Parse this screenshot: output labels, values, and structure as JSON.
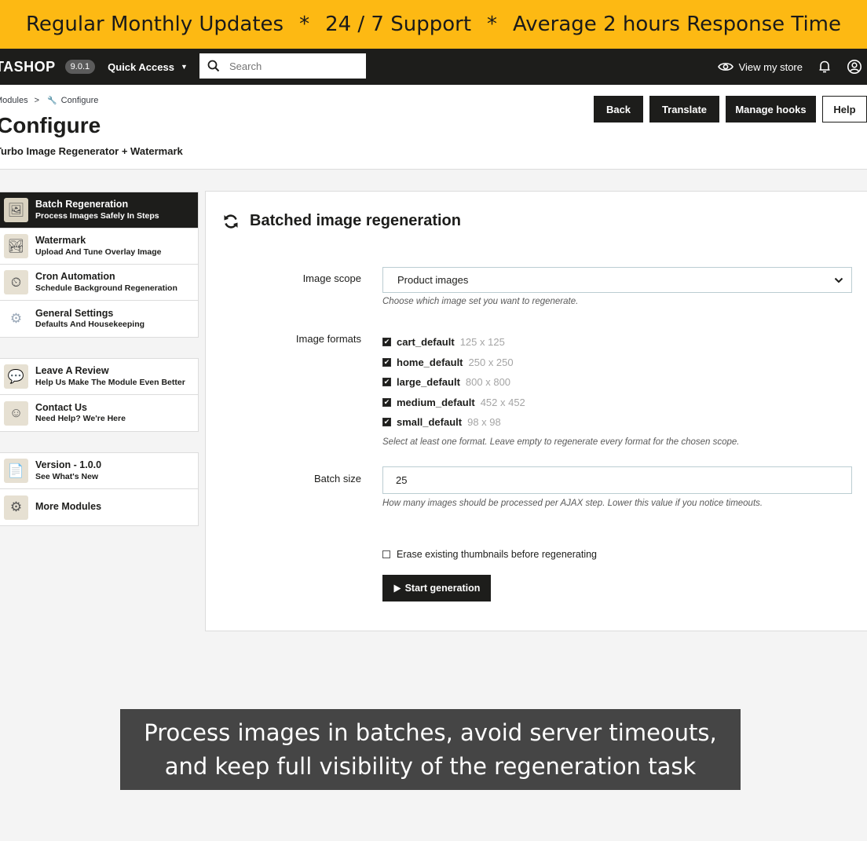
{
  "promo": {
    "items": [
      "Regular Monthly Updates",
      "24 / 7 Support",
      "Average 2 hours Response Time"
    ],
    "separator": "*"
  },
  "topnav": {
    "brand": "TASHOP",
    "version": "9.0.1",
    "quick_access": "Quick Access",
    "search_placeholder": "Search",
    "view_store": "View my store"
  },
  "header": {
    "breadcrumb": [
      "Modules",
      ">",
      "Configure"
    ],
    "title": "Configure",
    "subtitle": "Turbo Image Regenerator + Watermark",
    "buttons": {
      "back": "Back",
      "translate": "Translate",
      "manage_hooks": "Manage hooks",
      "help": "Help"
    }
  },
  "sidebar": {
    "groups": [
      [
        {
          "title": "Batch Regeneration",
          "sub": "Process Images Safely In Steps",
          "icon": "batch-images-icon",
          "active": true
        },
        {
          "title": "Watermark",
          "sub": "Upload And Tune Overlay Image",
          "icon": "watermark-icon"
        },
        {
          "title": "Cron Automation",
          "sub": "Schedule Background Regeneration",
          "icon": "clock-gear-icon"
        },
        {
          "title": "General Settings",
          "sub": "Defaults And Housekeeping",
          "icon": "gear-icon"
        }
      ],
      [
        {
          "title": "Leave A Review",
          "sub": "Help Us Make The Module Even Better",
          "icon": "review-icon"
        },
        {
          "title": "Contact Us",
          "sub": "Need Help? We're Here",
          "icon": "support-icon"
        }
      ],
      [
        {
          "title": "Version - 1.0.0",
          "sub": "See What's New",
          "icon": "changelog-icon"
        },
        {
          "title": "More Modules",
          "sub": "",
          "icon": "modules-icon"
        }
      ]
    ]
  },
  "panel": {
    "title": "Batched image regeneration",
    "image_scope": {
      "label": "Image scope",
      "value": "Product images",
      "help": "Choose which image set you want to regenerate."
    },
    "image_formats": {
      "label": "Image formats",
      "items": [
        {
          "name": "cart_default",
          "size": "125 x 125",
          "checked": true
        },
        {
          "name": "home_default",
          "size": "250 x 250",
          "checked": true
        },
        {
          "name": "large_default",
          "size": "800 x 800",
          "checked": true
        },
        {
          "name": "medium_default",
          "size": "452 x 452",
          "checked": true
        },
        {
          "name": "small_default",
          "size": "98 x 98",
          "checked": true
        }
      ],
      "help": "Select at least one format. Leave empty to regenerate every format for the chosen scope."
    },
    "batch_size": {
      "label": "Batch size",
      "value": "25",
      "help": "How many images should be processed per AJAX step. Lower this value if you notice timeouts."
    },
    "erase_label": "Erase existing thumbnails before regenerating",
    "erase_checked": false,
    "start_label": "Start generation"
  },
  "caption": {
    "line1": "Process images in batches, avoid server timeouts,",
    "line2": "and keep full visibility of the regeneration task"
  },
  "colors": {
    "promo_bg": "#fdb913",
    "nav_bg": "#1d1d1b",
    "caption_bg": "#454545"
  }
}
